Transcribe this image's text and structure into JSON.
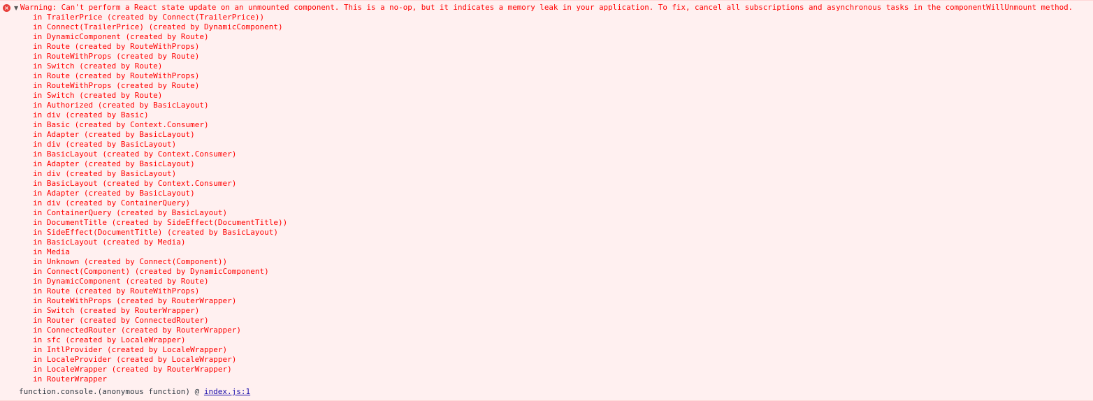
{
  "console": {
    "warning": "Warning: Can't perform a React state update on an unmounted component. This is a no-op, but it indicates a memory leak in your application. To fix, cancel all subscriptions and asynchronous tasks in the componentWillUnmount method.",
    "icon": "error-icon",
    "error_glyph": "×",
    "toggle_glyph": "▼",
    "stack": [
      "in TrailerPrice (created by Connect(TrailerPrice))",
      "in Connect(TrailerPrice) (created by DynamicComponent)",
      "in DynamicComponent (created by Route)",
      "in Route (created by RouteWithProps)",
      "in RouteWithProps (created by Route)",
      "in Switch (created by Route)",
      "in Route (created by RouteWithProps)",
      "in RouteWithProps (created by Route)",
      "in Switch (created by Route)",
      "in Authorized (created by BasicLayout)",
      "in div (created by Basic)",
      "in Basic (created by Context.Consumer)",
      "in Adapter (created by BasicLayout)",
      "in div (created by BasicLayout)",
      "in BasicLayout (created by Context.Consumer)",
      "in Adapter (created by BasicLayout)",
      "in div (created by BasicLayout)",
      "in BasicLayout (created by Context.Consumer)",
      "in Adapter (created by BasicLayout)",
      "in div (created by ContainerQuery)",
      "in ContainerQuery (created by BasicLayout)",
      "in DocumentTitle (created by SideEffect(DocumentTitle))",
      "in SideEffect(DocumentTitle) (created by BasicLayout)",
      "in BasicLayout (created by Media)",
      "in Media",
      "in Unknown (created by Connect(Component))",
      "in Connect(Component) (created by DynamicComponent)",
      "in DynamicComponent (created by Route)",
      "in Route (created by RouteWithProps)",
      "in RouteWithProps (created by RouterWrapper)",
      "in Switch (created by RouterWrapper)",
      "in Router (created by ConnectedRouter)",
      "in ConnectedRouter (created by RouterWrapper)",
      "in sfc (created by LocaleWrapper)",
      "in IntlProvider (created by LocaleWrapper)",
      "in LocaleProvider (created by LocaleWrapper)",
      "in LocaleWrapper (created by RouterWrapper)",
      "in RouterWrapper"
    ],
    "footer_prefix": "function.console.(anonymous function) @ ",
    "source_link": "index.js:1"
  },
  "colors": {
    "error_text": "#ff0000",
    "error_background": "#fff0f0",
    "link": "#1a0dab"
  }
}
